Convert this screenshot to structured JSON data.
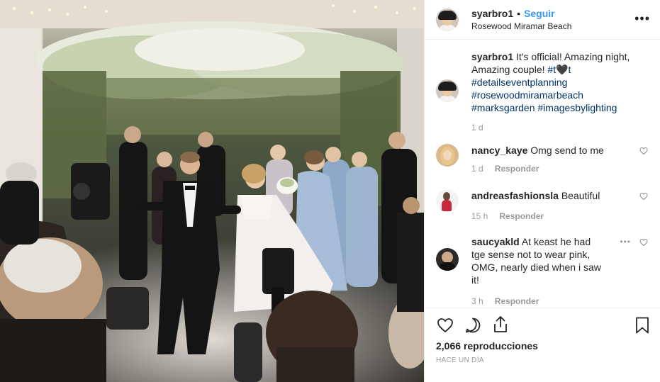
{
  "post": {
    "username": "syarbro1",
    "separator": "•",
    "follow_label": "Seguir",
    "location": "Rosewood Miramar Beach",
    "more_label": "•••"
  },
  "caption": {
    "username": "syarbro1",
    "text": "It's official! Amazing night, Amazing couple!",
    "tag_t1": "#t",
    "heart_emoji": "🖤",
    "tag_t2": "t",
    "hashtags": [
      "#detailseventplanning",
      "#rosewoodmiramarbeach",
      "#marksgarden",
      "#imagesbylighting"
    ],
    "time": "1 d"
  },
  "comments": [
    {
      "username": "nancy_kaye",
      "text": "Omg send to me",
      "time": "1 d",
      "reply_label": "Responder"
    },
    {
      "username": "andreasfashionsla",
      "text": "Beautiful",
      "time": "15 h",
      "reply_label": "Responder"
    },
    {
      "username": "saucyakld",
      "text": "At keast he had tge sense not to wear pink, OMG, nearly died when i saw it!",
      "time": "3 h",
      "reply_label": "Responder",
      "more_label": "•••"
    }
  ],
  "footer": {
    "views": "2,066 reproducciones",
    "posted": "HACE UN DÍA"
  },
  "icons": [
    "heart-icon",
    "comment-icon",
    "share-icon",
    "bookmark-icon"
  ],
  "colors": {
    "link": "#3897f0",
    "hashtag": "#003569",
    "meta": "#999999",
    "text": "#262626"
  }
}
